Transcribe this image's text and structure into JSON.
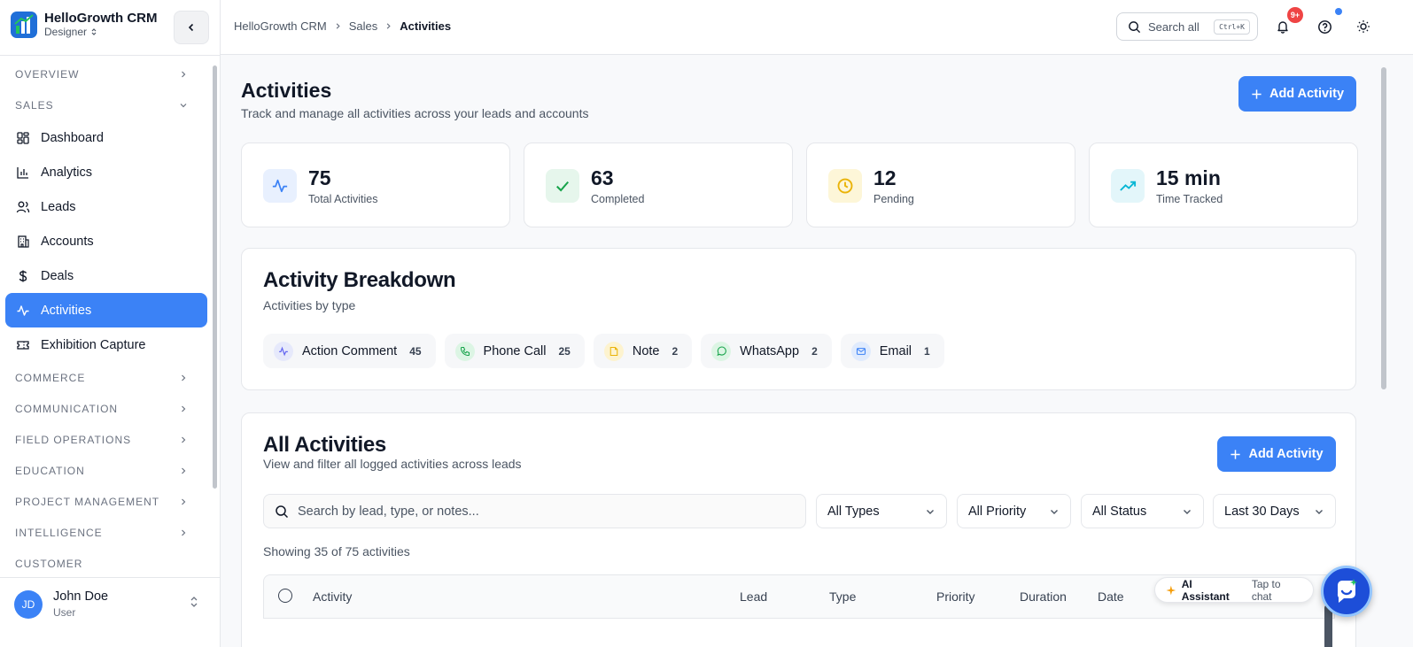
{
  "brand": {
    "name": "HelloGrowth CRM",
    "role": "Designer"
  },
  "nav": {
    "sections_top": [
      {
        "label": "OVERVIEW"
      },
      {
        "label": "SALES"
      }
    ],
    "items": [
      {
        "label": "Dashboard",
        "icon": "dashboard-icon"
      },
      {
        "label": "Analytics",
        "icon": "bar-chart-icon"
      },
      {
        "label": "Leads",
        "icon": "users-icon"
      },
      {
        "label": "Accounts",
        "icon": "building-icon"
      },
      {
        "label": "Deals",
        "icon": "dollar-icon"
      },
      {
        "label": "Activities",
        "icon": "activity-icon",
        "active": true
      },
      {
        "label": "Exhibition Capture",
        "icon": "ticket-icon"
      }
    ],
    "sections_bottom": [
      {
        "label": "COMMERCE"
      },
      {
        "label": "COMMUNICATION"
      },
      {
        "label": "FIELD OPERATIONS"
      },
      {
        "label": "EDUCATION"
      },
      {
        "label": "PROJECT MANAGEMENT"
      },
      {
        "label": "INTELLIGENCE"
      },
      {
        "label": "CUSTOMER"
      }
    ]
  },
  "user": {
    "initials": "JD",
    "name": "John Doe",
    "role": "User"
  },
  "topbar": {
    "breadcrumb": [
      "HelloGrowth CRM",
      "Sales",
      "Activities"
    ],
    "search_label": "Search all",
    "search_shortcut": "Ctrl+K",
    "notification_badge": "9+"
  },
  "header": {
    "title": "Activities",
    "subtitle": "Track and manage all activities across your leads and accounts",
    "add_label": "Add Activity"
  },
  "stats": [
    {
      "value": "75",
      "label": "Total Activities",
      "icon": "activity-icon",
      "color": "#3b82f6",
      "bg": "#e8f0fe"
    },
    {
      "value": "63",
      "label": "Completed",
      "icon": "check-icon",
      "color": "#16a34a",
      "bg": "#e6f6ec"
    },
    {
      "value": "12",
      "label": "Pending",
      "icon": "clock-icon",
      "color": "#eab308",
      "bg": "#fdf6d8"
    },
    {
      "value": "15 min",
      "label": "Time Tracked",
      "icon": "trending-up-icon",
      "color": "#06b6d4",
      "bg": "#e3f6fa"
    }
  ],
  "breakdown": {
    "title": "Activity Breakdown",
    "subtitle": "Activities by type",
    "chips": [
      {
        "label": "Action Comment",
        "count": "45",
        "icon": "activity-icon",
        "color": "#6366f1",
        "bg": "#e6e9fb"
      },
      {
        "label": "Phone Call",
        "count": "25",
        "icon": "phone-icon",
        "color": "#16a34a",
        "bg": "#dcf5e4"
      },
      {
        "label": "Note",
        "count": "2",
        "icon": "note-icon",
        "color": "#eab308",
        "bg": "#fdf3cf"
      },
      {
        "label": "WhatsApp",
        "count": "2",
        "icon": "whatsapp-icon",
        "color": "#16a34a",
        "bg": "#dcf5e4"
      },
      {
        "label": "Email",
        "count": "1",
        "icon": "mail-icon",
        "color": "#3b82f6",
        "bg": "#e0ebfd"
      }
    ]
  },
  "all_activities": {
    "title": "All Activities",
    "subtitle": "View and filter all logged activities across leads",
    "add_label": "Add Activity",
    "search_placeholder": "Search by lead, type, or notes...",
    "filters": [
      "All Types",
      "All Priority",
      "All Status",
      "Last 30 Days"
    ],
    "showing": "Showing 35 of 75 activities",
    "columns": [
      "Activity",
      "Lead",
      "Type",
      "Priority",
      "Duration",
      "Date"
    ]
  },
  "ai_assistant": {
    "label": "AI Assistant",
    "hint": "Tap to chat"
  }
}
